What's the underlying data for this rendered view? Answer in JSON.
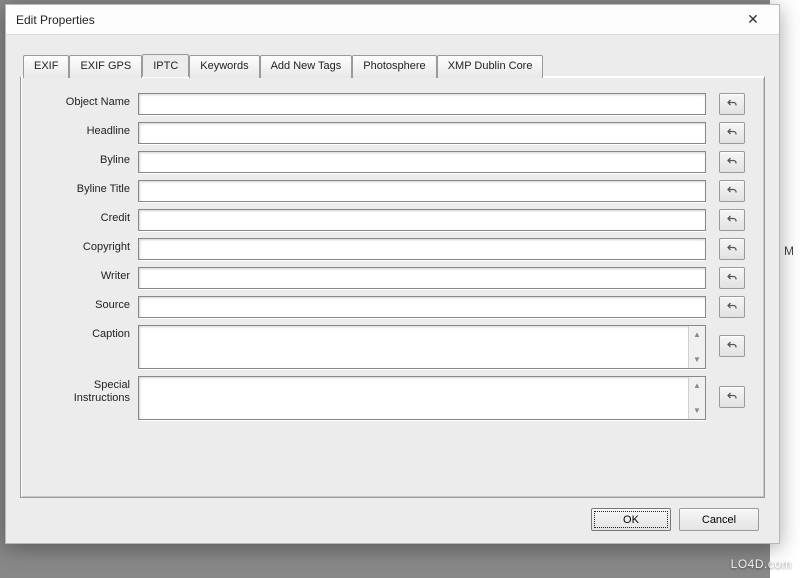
{
  "window": {
    "title": "Edit Properties",
    "close_glyph": "✕"
  },
  "tabs": [
    {
      "label": "EXIF"
    },
    {
      "label": "EXIF GPS"
    },
    {
      "label": "IPTC"
    },
    {
      "label": "Keywords"
    },
    {
      "label": "Add New Tags"
    },
    {
      "label": "Photosphere"
    },
    {
      "label": "XMP Dublin Core"
    }
  ],
  "active_tab_index": 2,
  "iptc": {
    "fields": {
      "object_name": {
        "label": "Object Name",
        "value": ""
      },
      "headline": {
        "label": "Headline",
        "value": ""
      },
      "byline": {
        "label": "Byline",
        "value": ""
      },
      "byline_title": {
        "label": "Byline Title",
        "value": ""
      },
      "credit": {
        "label": "Credit",
        "value": ""
      },
      "copyright": {
        "label": "Copyright",
        "value": ""
      },
      "writer": {
        "label": "Writer",
        "value": ""
      },
      "source": {
        "label": "Source",
        "value": ""
      },
      "caption": {
        "label": "Caption",
        "value": ""
      },
      "special_instructions": {
        "label": "Special\nInstructions",
        "value": ""
      }
    }
  },
  "buttons": {
    "ok": "OK",
    "cancel": "Cancel"
  },
  "icons": {
    "undo": "undo-icon"
  },
  "watermark": "LO4D.com",
  "bg_letter": "M"
}
